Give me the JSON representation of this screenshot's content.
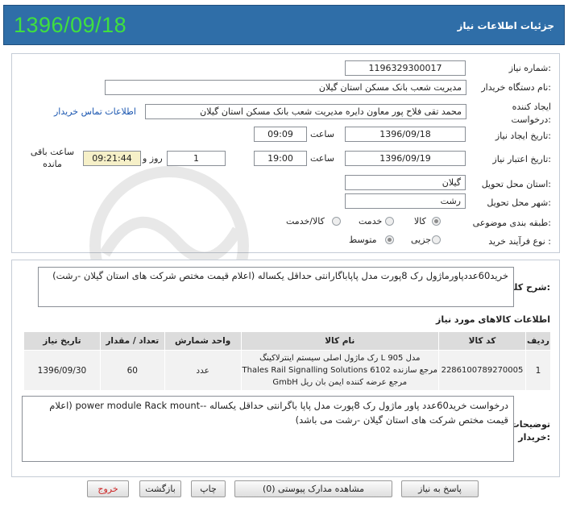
{
  "header": {
    "title": "جزئیات اطلاعات نیاز",
    "date_stamp": "1396/09/18"
  },
  "form": {
    "need_number": {
      "label": "شماره نیاز:",
      "value": "1196329300017"
    },
    "buyer_org": {
      "label": "نام دستگاه خریدار:",
      "value": "مدیریت شعب بانک مسکن استان گیلان"
    },
    "requester": {
      "label": "ایجاد کننده درخواست:",
      "value": "محمد تقی  فلاح پور معاون دایره  مدیریت شعب بانک مسکن استان گیلان",
      "contact_link": "اطلاعات تماس خریدار"
    },
    "created": {
      "label": "تاریخ ایجاد نیاز:",
      "date": "1396/09/18",
      "time_label": "ساعت",
      "time": "09:09"
    },
    "validity": {
      "label": "تاریخ اعتبار نیاز:",
      "date": "1396/09/19",
      "time_label": "ساعت",
      "time": "19:00",
      "days": "1",
      "days_label": "روز و",
      "remaining": "09:21:44",
      "remaining_label": "ساعت باقی مانده"
    },
    "delivery_province": {
      "label": "استان محل تحویل:",
      "value": "گیلان"
    },
    "delivery_city": {
      "label": "شهر محل تحویل:",
      "value": "رشت"
    },
    "category": {
      "label": "طبقه بندی موضوعی:",
      "options": [
        "کالا",
        "خدمت",
        "کالا/خدمت"
      ],
      "selected": "کالا"
    },
    "process": {
      "label": "نوع فرآیند خرید :",
      "options": [
        "جزیی",
        "متوسط"
      ],
      "selected": "متوسط"
    }
  },
  "summary": {
    "label": "شرح کلی نیاز:",
    "text": "خرید60عددپاورماژول رک 8پورت مدل پاپاباگارانتی حداقل یکساله (اعلام قیمت مختص شرکت های استان گیلان -رشت)"
  },
  "items_section": {
    "title": "اطلاعات کالاهای مورد نیاز",
    "columns": [
      "ردیف",
      "کد کالا",
      "نام کالا",
      "واحد شمارش",
      "تعداد / مقدار",
      "تاریخ نیاز"
    ],
    "rows": [
      {
        "row": "1",
        "code": "2286100789270005",
        "name_lines": [
          "رک ماژول اصلی سیستم اینترلاکینگ L 905 مدل",
          "Thales Rail Signalling Solutions 6102 مرجع سازنده",
          "GmbH مرجع عرضه کننده ایمن بان ریل"
        ],
        "unit": "عدد",
        "qty": "60",
        "date": "1396/09/30"
      }
    ]
  },
  "buyer_notes": {
    "label": "توضیحات خریدار:",
    "text": "درخواست خرید60عدد پاور ماژول رک 8پورت مدل پاپا باگرانتی حداقل یکساله --power module Rack mount (اعلام قیمت مختص شرکت های استان گیلان -رشت می باشد)"
  },
  "buttons": {
    "reply": "پاسخ به نیاز",
    "view_docs": "مشاهده مدارک پیوستی (0)",
    "print": "چاپ",
    "back": "بازگشت",
    "exit": "خروج"
  },
  "colors": {
    "header_bg": "#2f6ea8",
    "date_stamp": "#3fe03f",
    "link": "#1a56b0",
    "exit_text": "#cc2222"
  }
}
